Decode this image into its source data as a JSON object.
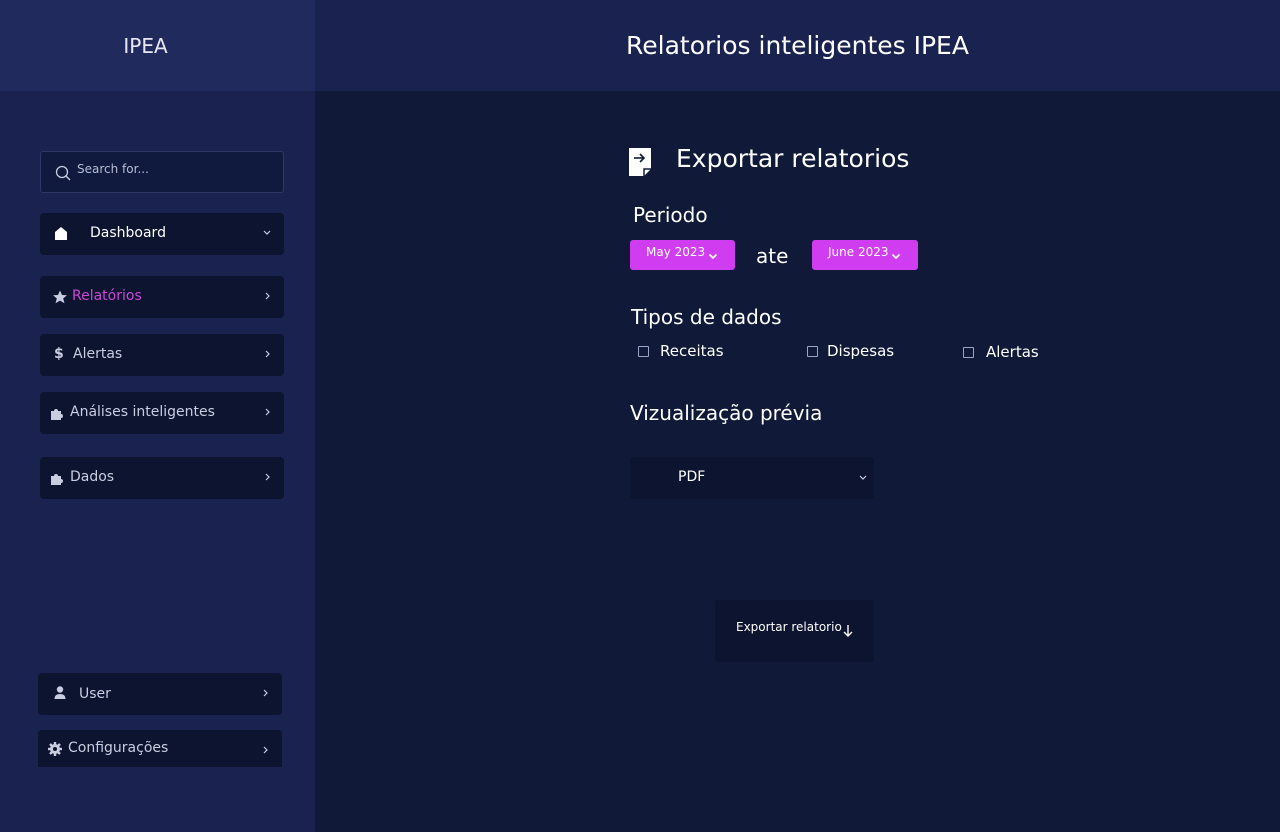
{
  "app": {
    "title": "IPEA"
  },
  "header": {
    "title": "Relatorios inteligentes IPEA"
  },
  "search": {
    "placeholder": "Search for..."
  },
  "sidebar": {
    "items": [
      {
        "label": "Dashboard",
        "icon": "home-icon"
      },
      {
        "label": "Relatórios",
        "icon": "star-icon",
        "active": true
      },
      {
        "label": "Alertas",
        "icon": "dollar-icon"
      },
      {
        "label": "Análises inteligentes",
        "icon": "puzzle-icon"
      },
      {
        "label": "Dados",
        "icon": "puzzle-icon"
      }
    ],
    "footer": [
      {
        "label": "User",
        "icon": "user-icon"
      },
      {
        "label": "Configurações",
        "icon": "gear-icon"
      }
    ]
  },
  "main": {
    "title": "Exportar relatorios",
    "period": {
      "label": "Periodo",
      "from": "May 2023",
      "separator": "ate",
      "to": "June 2023"
    },
    "data_types": {
      "label": "Tipos de dados",
      "options": [
        "Receitas",
        "Dispesas",
        "Alertas"
      ]
    },
    "preview": {
      "label": "Vizualização prévia",
      "selected": "PDF"
    },
    "export_button": "Exportar relatorio"
  },
  "colors": {
    "background": "#101a38",
    "sidebar": "#1a2350",
    "accent": "#d03df0",
    "active_text": "#c84ad6"
  }
}
